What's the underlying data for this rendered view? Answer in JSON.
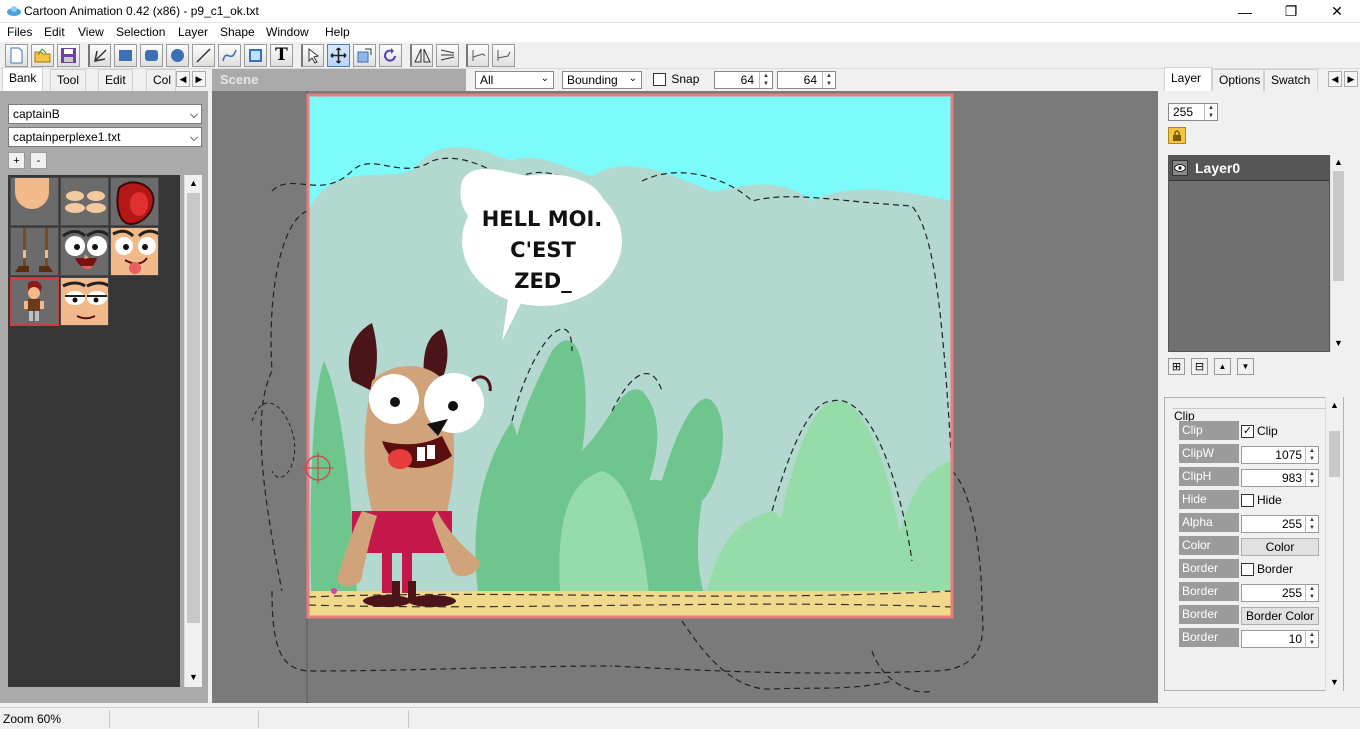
{
  "window": {
    "title": "Cartoon Animation 0.42 (x86) - p9_c1_ok.txt",
    "minimize": "—",
    "maximize": "❐",
    "close": "✕"
  },
  "menu": [
    "Files",
    "Edit",
    "View",
    "Selection",
    "Layer",
    "Shape",
    "Window",
    "Help"
  ],
  "toolbar": {
    "text_tool": "T",
    "icons": [
      "new-file-icon",
      "open-folder-icon",
      "save-icon",
      "pen-icon",
      "rectangle-icon",
      "rounded-rect-icon",
      "ellipse-icon",
      "line-icon",
      "curve-icon",
      "image-icon",
      "text-icon",
      "select-arrow-icon",
      "move-icon",
      "resize-icon",
      "rotate-icon",
      "flip-icon",
      "skew-icon",
      "bone-add-icon",
      "bone-remove-icon"
    ]
  },
  "left_tabs": [
    "Bank",
    "Tool",
    "Edit",
    "Col"
  ],
  "bank": {
    "combo1": "captainB",
    "combo2": "captainperplexe1.txt",
    "add": "+",
    "remove": "-",
    "thumbnails": [
      "head-shape",
      "eyes",
      "hat",
      "legs",
      "face-surprised",
      "face-tongue",
      "captain-full",
      "face-tired"
    ]
  },
  "scene": {
    "label": "Scene",
    "filter": "All",
    "mode": "Bounding",
    "snap_label": "Snap",
    "snap_x": "64",
    "snap_y": "64"
  },
  "canvas": {
    "speech_line1": "HELL MOI.",
    "speech_line2": "C'EST",
    "speech_line3": "ZED_",
    "colors": {
      "sky": "#7dfafa",
      "hills": "#b2d8d0",
      "frame": "#e97c7c",
      "ground": "#f2d88a",
      "plant_dark": "#6fc58e",
      "plant_light": "#96dca8"
    }
  },
  "right_tabs": [
    "Layer",
    "Options",
    "Swatch"
  ],
  "layer_panel": {
    "alpha": "255",
    "layers": [
      "Layer0"
    ]
  },
  "props": {
    "section": "Clip",
    "rows": [
      {
        "label": "Clip",
        "kind": "check",
        "text": "Clip",
        "checked": true
      },
      {
        "label": "ClipW",
        "kind": "num",
        "text": "1075"
      },
      {
        "label": "ClipH",
        "kind": "num",
        "text": "983"
      },
      {
        "label": "Hide",
        "kind": "check",
        "text": "Hide",
        "checked": false
      },
      {
        "label": "Alpha",
        "kind": "num",
        "text": "255"
      },
      {
        "label": "Color",
        "kind": "btn",
        "text": "Color"
      },
      {
        "label": "Border",
        "kind": "check",
        "text": "Border",
        "checked": false
      },
      {
        "label": "Border",
        "kind": "num",
        "text": "255"
      },
      {
        "label": "Border",
        "kind": "btn",
        "text": "Border Color"
      },
      {
        "label": "Border",
        "kind": "num",
        "text": "10"
      }
    ]
  },
  "status": {
    "zoom": "Zoom 60%"
  }
}
